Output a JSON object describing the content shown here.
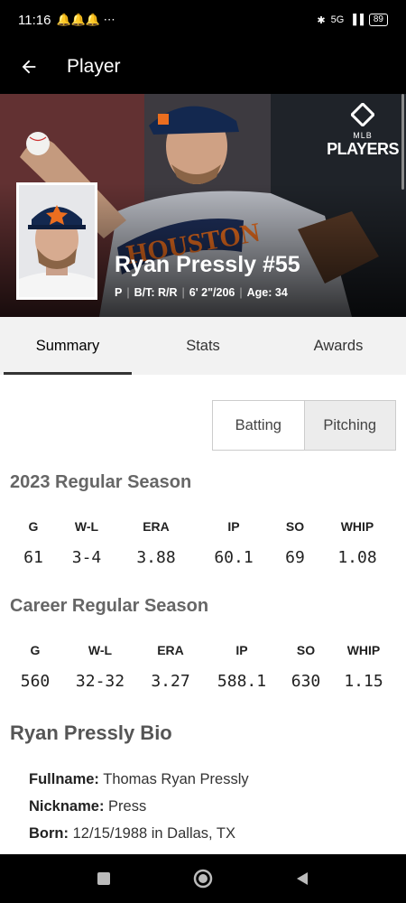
{
  "status": {
    "time": "11:16",
    "battery": "89",
    "network": "5G"
  },
  "app_bar": {
    "title": "Player"
  },
  "hero": {
    "brand_top": "MLB",
    "brand_word": "PLAYERS",
    "name": "Ryan Pressly #55",
    "position": "P",
    "bats_throws": "B/T: R/R",
    "height_weight": "6' 2\"/206",
    "age": "Age: 34"
  },
  "tabs": [
    {
      "label": "Summary",
      "active": true
    },
    {
      "label": "Stats",
      "active": false
    },
    {
      "label": "Awards",
      "active": false
    }
  ],
  "toggle": {
    "batting": "Batting",
    "pitching": "Pitching",
    "selected": "Pitching"
  },
  "season": {
    "title": "2023 Regular Season",
    "headers": [
      "G",
      "W-L",
      "ERA",
      "IP",
      "SO",
      "WHIP"
    ],
    "values": [
      "61",
      "3-4",
      "3.88",
      "60.1",
      "69",
      "1.08"
    ]
  },
  "career": {
    "title": "Career Regular Season",
    "headers": [
      "G",
      "W-L",
      "ERA",
      "IP",
      "SO",
      "WHIP"
    ],
    "values": [
      "560",
      "32-32",
      "3.27",
      "588.1",
      "630",
      "1.15"
    ]
  },
  "bio": {
    "title": "Ryan Pressly Bio",
    "items": [
      {
        "label": "Fullname:",
        "value": "Thomas Ryan Pressly"
      },
      {
        "label": "Nickname:",
        "value": "Press"
      },
      {
        "label": "Born:",
        "value": "12/15/1988 in Dallas, TX"
      }
    ]
  },
  "colors": {
    "astros_navy": "#002d62",
    "astros_orange": "#eb6e1f"
  }
}
